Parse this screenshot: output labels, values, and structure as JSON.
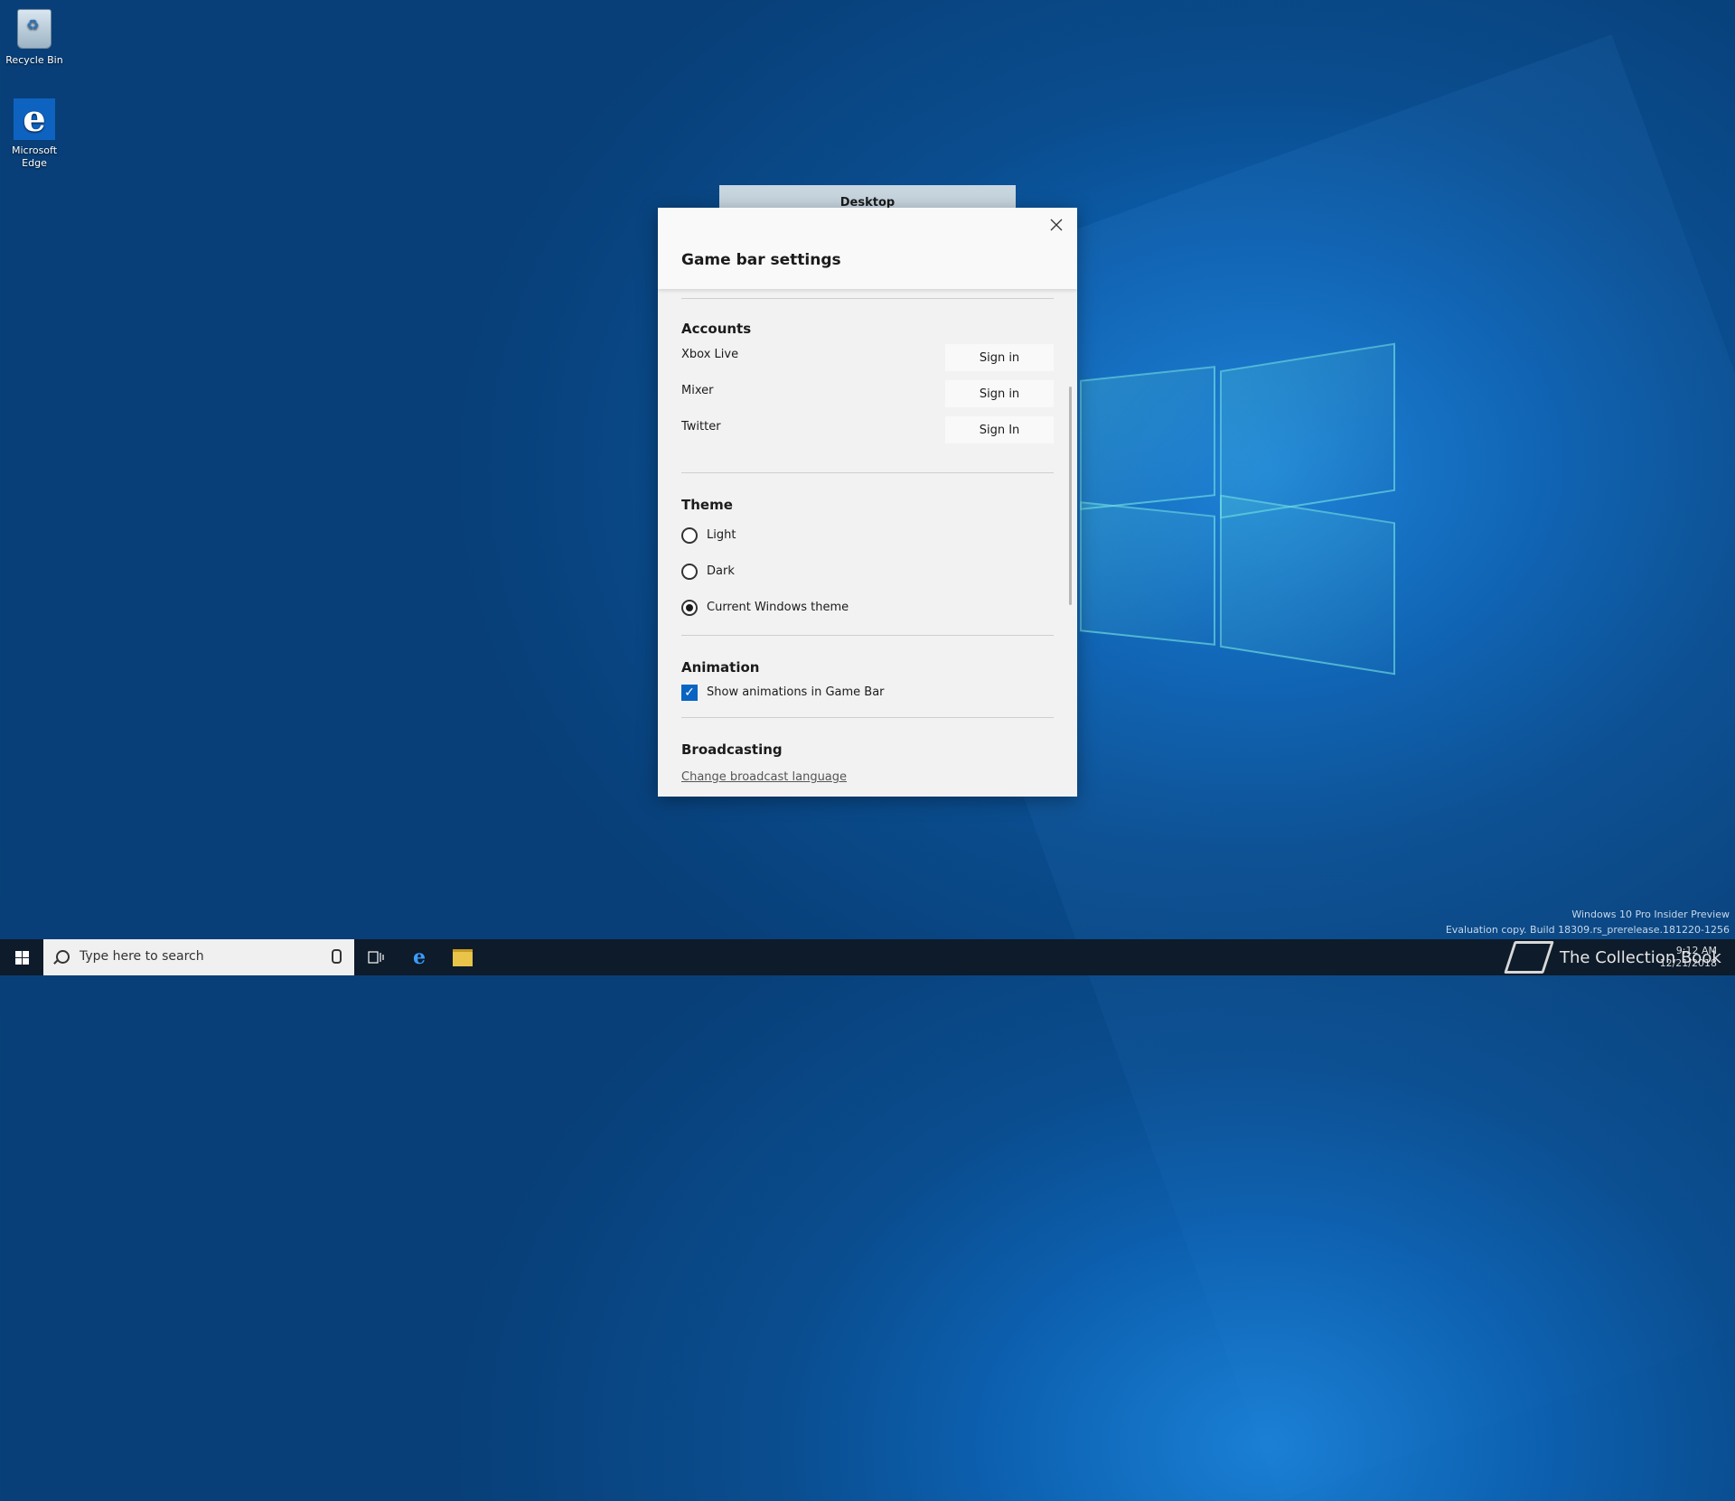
{
  "desktop": {
    "icons": [
      {
        "label": "Recycle Bin"
      },
      {
        "label": "Microsoft Edge"
      }
    ]
  },
  "desktop_tab": {
    "label": "Desktop"
  },
  "dialog": {
    "title": "Game bar settings",
    "accounts": {
      "heading": "Accounts",
      "rows": [
        {
          "name": "Xbox Live",
          "button": "Sign in"
        },
        {
          "name": "Mixer",
          "button": "Sign in"
        },
        {
          "name": "Twitter",
          "button": "Sign In"
        }
      ]
    },
    "theme": {
      "heading": "Theme",
      "options": [
        {
          "label": "Light",
          "selected": false
        },
        {
          "label": "Dark",
          "selected": false
        },
        {
          "label": "Current Windows theme",
          "selected": true
        }
      ]
    },
    "animation": {
      "heading": "Animation",
      "checkbox_label": "Show animations in Game Bar",
      "checked": true
    },
    "broadcasting": {
      "heading": "Broadcasting",
      "link": "Change broadcast language"
    }
  },
  "taskbar": {
    "search_placeholder": "Type here to search",
    "clock_time": "9:12 AM",
    "clock_date": "12/21/2018"
  },
  "watermark": {
    "line1": "Windows 10 Pro Insider Preview",
    "line2": "Evaluation copy. Build 18309.rs_prerelease.181220-1256"
  },
  "brand": {
    "label": "The Collection Book"
  },
  "colors": {
    "accent": "#0a64c2",
    "taskbar": "#0d1b2a"
  }
}
